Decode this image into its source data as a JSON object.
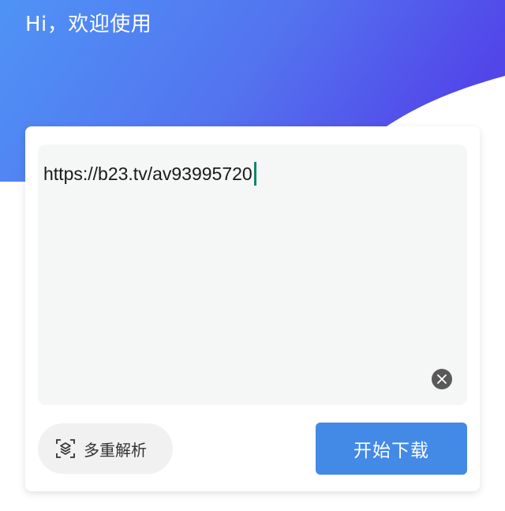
{
  "header": {
    "greeting": "Hi，欢迎使用"
  },
  "colors": {
    "hero_gradient_start": "#4f93f6",
    "hero_gradient_end": "#5246e9",
    "primary_button": "#4389e6",
    "input_background": "#f4f7f6",
    "cursor": "#11856f"
  },
  "input": {
    "value": "https://b23.tv/av93995720"
  },
  "actions": {
    "multi_parse_label": "多重解析",
    "download_label": "开始下载"
  },
  "icons": {
    "clear": "clear-circle-icon",
    "multi_parse": "scan-layers-icon"
  }
}
